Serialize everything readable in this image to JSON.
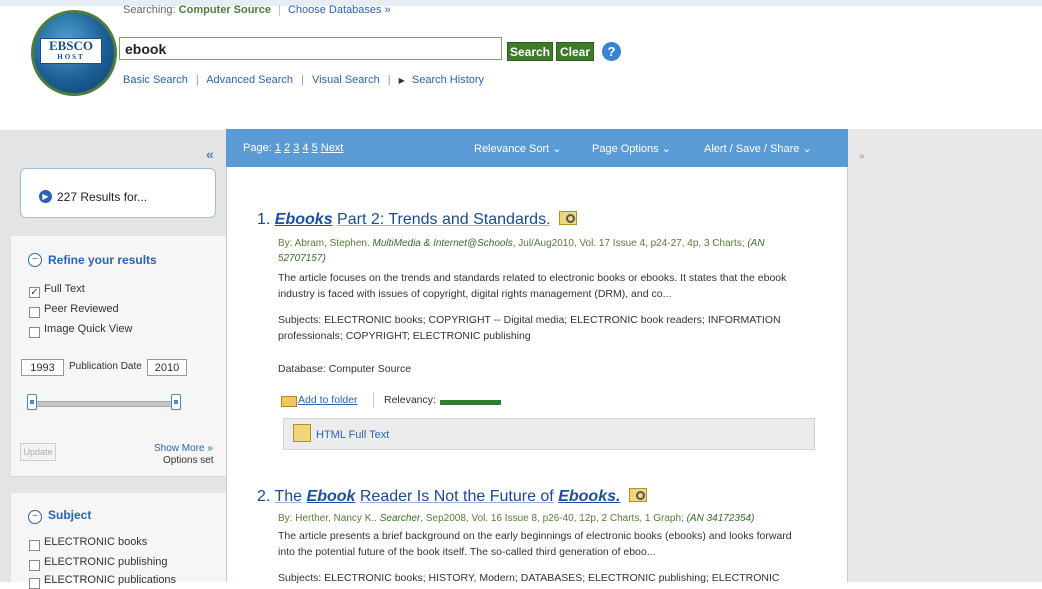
{
  "header": {
    "searching_prefix": "Searching:",
    "database": "Computer Source",
    "choose_databases": "Choose Databases »",
    "logo_text": "EBSCO",
    "logo_sub": "HOST",
    "search_value": "ebook",
    "search_button": "Search",
    "clear_button": "Clear",
    "help_icon": "?",
    "links": [
      "Basic Search",
      "Advanced Search",
      "Visual Search",
      "Search History"
    ]
  },
  "results_bar": {
    "page_label": "Page:",
    "pages": [
      "1",
      "2",
      "3",
      "4",
      "5"
    ],
    "next": "Next",
    "relevance_sort": "Relevance Sort",
    "page_options": "Page Options",
    "alert_save_share": "Alert / Save / Share",
    "collapse_left": "«",
    "collapse_right": "»"
  },
  "left_panel": {
    "results_count_text": "227 Results for...",
    "refine_title": "Refine your results",
    "filters": [
      {
        "label": "Full Text",
        "checked": true
      },
      {
        "label": "Peer Reviewed",
        "checked": false
      },
      {
        "label": "Image Quick View",
        "checked": false
      }
    ],
    "pub_date_label": "Publication Date",
    "year_from": "1993",
    "year_to": "2010",
    "update_button": "Update",
    "show_more": "Show More »",
    "options_set": "Options set",
    "subject_title": "Subject",
    "subjects": [
      "ELECTRONIC books",
      "ELECTRONIC publishing",
      "ELECTRONIC publications"
    ]
  },
  "results": [
    {
      "number": "1.",
      "title_highlight": "Ebooks",
      "title_rest": "Part 2: Trends and Standards.",
      "byline_prefix": "By: Abram, Stephen.",
      "source": "MultiMedia & Internet@Schools",
      "byline_details": ", Jul/Aug2010, Vol. 17 Issue 4, p24-27, 4p, 3 Charts;",
      "an_line1": "(AN",
      "an_line2": "52707157)",
      "abstract_line1": "The article focuses on the trends and standards related to electronic books or ebooks. It states that the ebook",
      "abstract_line2": "industry is faced with issues of copyright, digital rights management (DRM), and co...",
      "subjects_line1": "Subjects: ELECTRONIC books; COPYRIGHT -- Digital media; ELECTRONIC book readers; INFORMATION",
      "subjects_line2": "professionals; COPYRIGHT; ELECTRONIC publishing",
      "database": "Database: Computer Source",
      "add_to_folder": "Add to folder",
      "relevancy_label": "Relevancy:",
      "relevancy": 1.0,
      "full_text": "HTML Full Text"
    },
    {
      "number": "2.",
      "title_pre": "The",
      "title_highlight": "Ebook",
      "title_mid": "Reader Is Not the Future of",
      "title_highlight2": "Ebooks.",
      "byline_prefix": "By: Herther, Nancy K..",
      "source": "Searcher",
      "byline_details": ", Sep2008, Vol. 16 Issue 8, p26-40, 12p, 2 Charts, 1 Graph;",
      "an": "(AN 34172354)",
      "abstract_line1": "The article presents a brief background on the early beginnings of electronic books (ebooks) and looks forward",
      "abstract_line2": "into the potential future of the book itself. The so-called third generation of eboo...",
      "subjects_line1": "Subjects: ELECTRONIC books; HISTORY, Modern; DATABASES; ELECTRONIC publishing; ELECTRONIC"
    }
  ],
  "colors": {
    "accent_blue": "#5b9bd5",
    "link_blue": "#2a64b0",
    "button_green": "#3d7a2a",
    "relevancy_green": "#2f7d2f"
  }
}
